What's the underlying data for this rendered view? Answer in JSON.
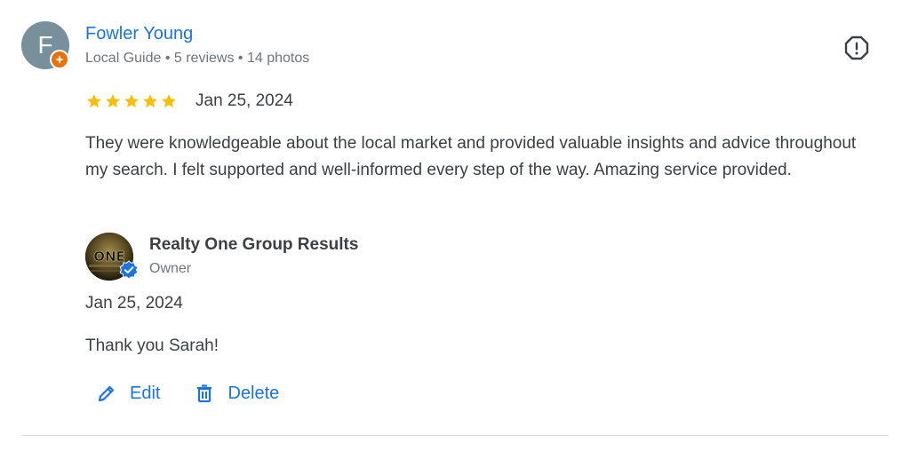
{
  "reviewer": {
    "initial": "F",
    "name": "Fowler Young",
    "meta": "Local Guide • 5 reviews • 14 photos"
  },
  "review": {
    "rating": 5,
    "date": "Jan 25, 2024",
    "text": "They were knowledgeable about the local market and provided valuable insights and advice throughout my search. I felt supported and well-informed every step of the way. Amazing service provided."
  },
  "owner_response": {
    "logo_text": "ONE",
    "owner_name": "Realty One Group Results",
    "role": "Owner",
    "date": "Jan 25, 2024",
    "text": "Thank you Sarah!"
  },
  "actions": {
    "edit_label": "Edit",
    "delete_label": "Delete"
  },
  "colors": {
    "link": "#1a73e8",
    "star": "#fbbc04",
    "badge": "#e8710a",
    "avatar_bg": "#78909c"
  }
}
